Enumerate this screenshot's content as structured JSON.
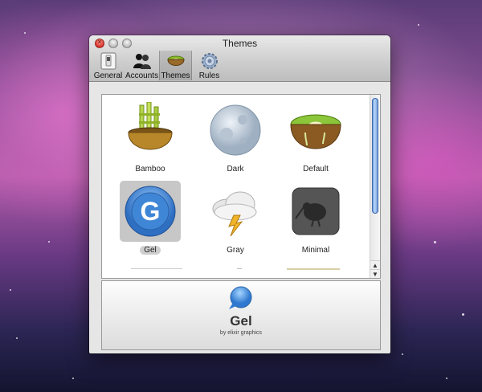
{
  "window": {
    "title": "Themes"
  },
  "toolbar": {
    "items": [
      {
        "label": "General",
        "icon": "switch-icon",
        "selected": false
      },
      {
        "label": "Accounts",
        "icon": "people-icon",
        "selected": false
      },
      {
        "label": "Themes",
        "icon": "kiwi-bowl-icon",
        "selected": true
      },
      {
        "label": "Rules",
        "icon": "gear-icon",
        "selected": false
      }
    ]
  },
  "themes": [
    {
      "name": "Bamboo",
      "icon": "bamboo-bowl-icon"
    },
    {
      "name": "Dark",
      "icon": "moon-icon"
    },
    {
      "name": "Default",
      "icon": "kiwi-icon"
    },
    {
      "name": "Gel",
      "icon": "gel-g-icon",
      "selected": true
    },
    {
      "name": "Gray",
      "icon": "storm-cloud-icon"
    },
    {
      "name": "Minimal",
      "icon": "kiwi-bird-icon"
    }
  ],
  "preview": {
    "name": "Gel",
    "byline": "by elixir graphics",
    "icon": "speech-bubble-icon"
  },
  "colors": {
    "accent_blue": "#4a90d9",
    "selection_gray": "#c7c7c7"
  }
}
